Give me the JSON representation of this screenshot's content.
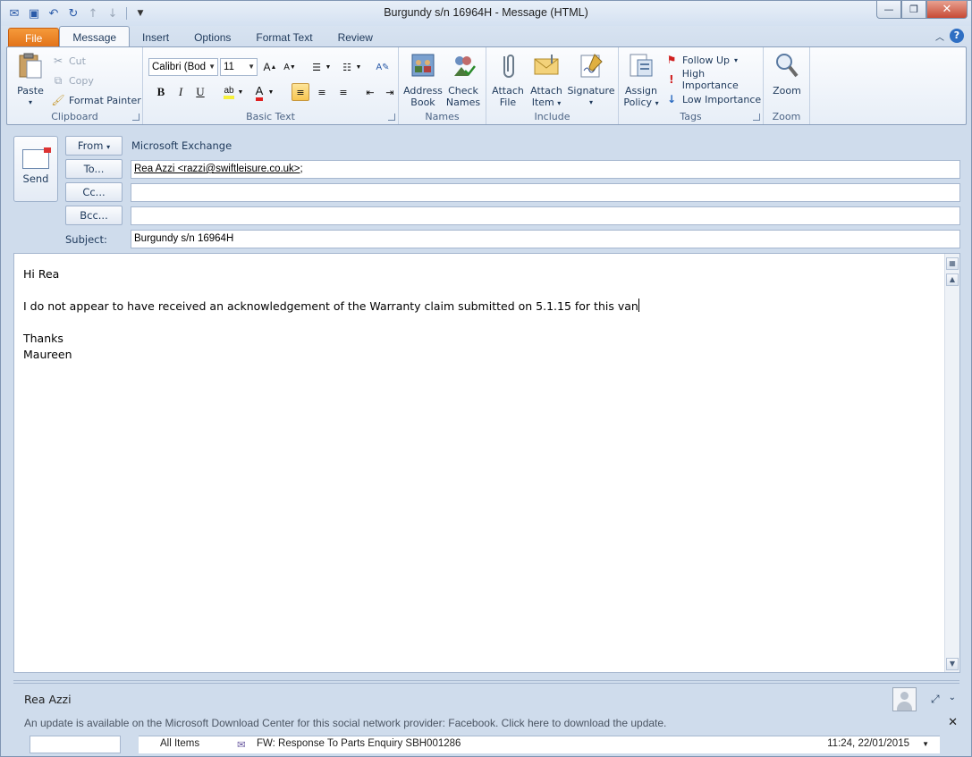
{
  "window": {
    "title": "Burgundy s/n 16964H  -  Message (HTML)",
    "controls": {
      "minimize": "—",
      "maximize": "❐",
      "close": "✕"
    }
  },
  "quick_access": {
    "icons": [
      "mail-icon",
      "save-icon",
      "undo-icon",
      "redo-icon",
      "up-arrow-icon",
      "down-arrow-icon",
      "customize-icon"
    ]
  },
  "tabs": [
    {
      "label": "File"
    },
    {
      "label": "Message"
    },
    {
      "label": "Insert"
    },
    {
      "label": "Options"
    },
    {
      "label": "Format Text"
    },
    {
      "label": "Review"
    }
  ],
  "ribbon": {
    "clipboard": {
      "label": "Clipboard",
      "paste": "Paste",
      "cut": "Cut",
      "copy": "Copy",
      "format_painter": "Format Painter"
    },
    "basic_text": {
      "label": "Basic Text",
      "font": "Calibri (Bod",
      "size": "11",
      "bold": "B",
      "italic": "I",
      "underline": "U"
    },
    "names": {
      "label": "Names",
      "address_book_1": "Address",
      "address_book_2": "Book",
      "check_names_1": "Check",
      "check_names_2": "Names"
    },
    "include": {
      "label": "Include",
      "attach_file_1": "Attach",
      "attach_file_2": "File",
      "attach_item_1": "Attach",
      "attach_item_2": "Item",
      "signature": "Signature"
    },
    "tags": {
      "label": "Tags",
      "assign_1": "Assign",
      "assign_2": "Policy",
      "follow_up": "Follow Up",
      "high": "High Importance",
      "low": "Low Importance"
    },
    "zoom": {
      "label": "Zoom",
      "zoom": "Zoom"
    }
  },
  "header": {
    "send": "Send",
    "from_btn": "From",
    "from_value": "Microsoft Exchange",
    "to_btn": "To...",
    "to_value": "Rea Azzi <razzi@swiftleisure.co.uk>",
    "to_suffix": ";",
    "cc_btn": "Cc...",
    "cc_value": "",
    "bcc_btn": "Bcc...",
    "bcc_value": "",
    "subject_label": "Subject:",
    "subject_value": "Burgundy s/n 16964H"
  },
  "body": {
    "line1": "Hi Rea",
    "line2": "",
    "line3": "I do not appear to have received an acknowledgement of the Warranty claim submitted on 5.1.15 for this van",
    "line4": "",
    "line5": "Thanks",
    "line6": "Maureen"
  },
  "people_pane": {
    "name": "Rea Azzi",
    "notice": "An update is available on the Microsoft Download Center for this social network provider: Facebook. Click here to download the update.",
    "feed_folder": "All Items",
    "feed_item": "FW: Response To Parts Enquiry SBH001286",
    "feed_time": "11:24, 22/01/2015"
  }
}
